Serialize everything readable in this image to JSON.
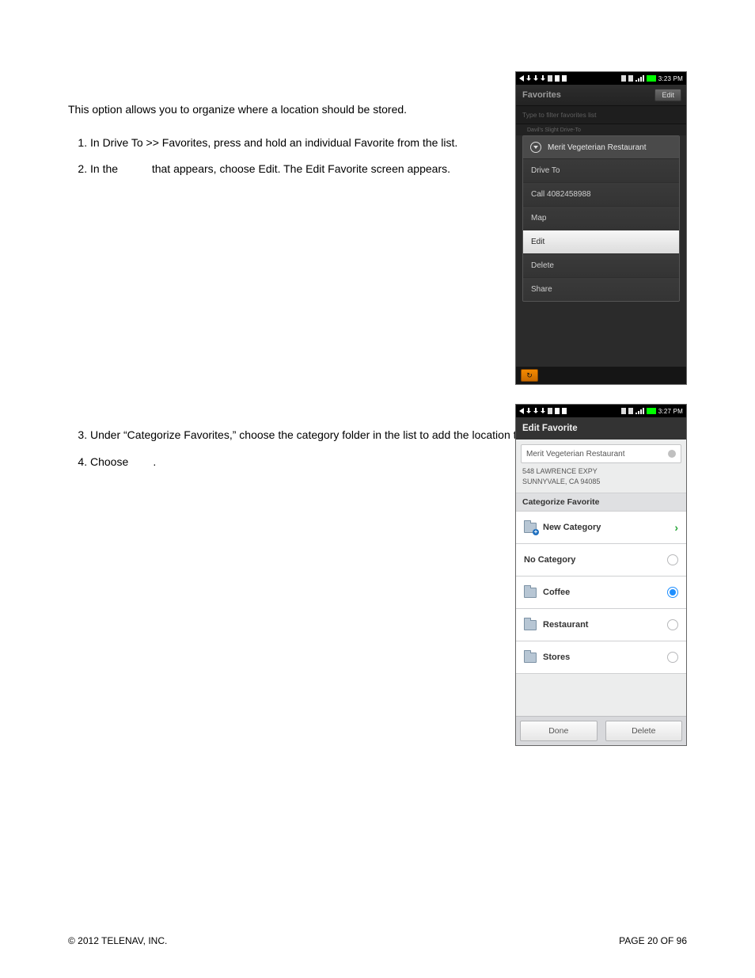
{
  "doc": {
    "intro": "This option allows you to organize where a location should be stored.",
    "step1": "In Drive To >> Favorites, press and hold an individual Favorite from the list.",
    "step2_a": "In the ",
    "step2_b": " that appears, choose Edit. The Edit Favorite screen appears.",
    "step3": "Under “Categorize Favorites,” choose the category folder in the list to add the location to the folder.",
    "step4_a": "Choose ",
    "step4_b": "."
  },
  "footer": {
    "copyright": "© 2012 TELENAV, INC.",
    "page": "PAGE 20 OF 96"
  },
  "ss1": {
    "time": "3:23 PM",
    "screen_title": "Favorites",
    "edit_btn": "Edit",
    "filter_placeholder": "Type to filter favorites list",
    "dimmed_row": "Davil's Slight Drive‑To",
    "ctx_title": "Merit Vegeterian Restaurant",
    "items": {
      "drive_to": "Drive To",
      "call": "Call 4082458988",
      "map": "Map",
      "edit": "Edit",
      "delete": "Delete",
      "share": "Share"
    },
    "syskey": "↻"
  },
  "ss2": {
    "time": "3:27 PM",
    "header": "Edit Favorite",
    "name": "Merit Vegeterian Restaurant",
    "addr_line1": "548 LAWRENCE EXPY",
    "addr_line2": "SUNNYVALE, CA 94085",
    "section": "Categorize Favorite",
    "rows": {
      "new_category": "New Category",
      "no_category": "No Category",
      "coffee": "Coffee",
      "restaurant": "Restaurant",
      "stores": "Stores"
    },
    "selected": "coffee",
    "chevron": "›",
    "buttons": {
      "done": "Done",
      "delete": "Delete"
    }
  }
}
